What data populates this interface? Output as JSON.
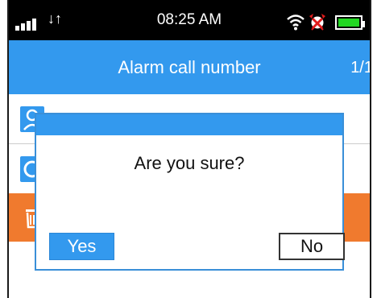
{
  "status_bar": {
    "time": "08:25 AM",
    "icons": [
      "signal-icon",
      "data-arrows-icon",
      "wifi-icon",
      "alarm-clock-icon",
      "battery-icon"
    ],
    "battery_color": "#22d722"
  },
  "header": {
    "title": "Alarm call number",
    "page_indicator": "1/1",
    "color": "#3399ee"
  },
  "list": {
    "items": [
      {
        "icon": "contact-icon",
        "selected": false
      },
      {
        "icon": "phone-icon",
        "selected": false
      },
      {
        "icon": "trash-icon",
        "selected": true,
        "highlight_color": "#f07a2e"
      }
    ]
  },
  "dialog": {
    "message": "Are you sure?",
    "yes_label": "Yes",
    "no_label": "No",
    "focused_button": "yes"
  }
}
